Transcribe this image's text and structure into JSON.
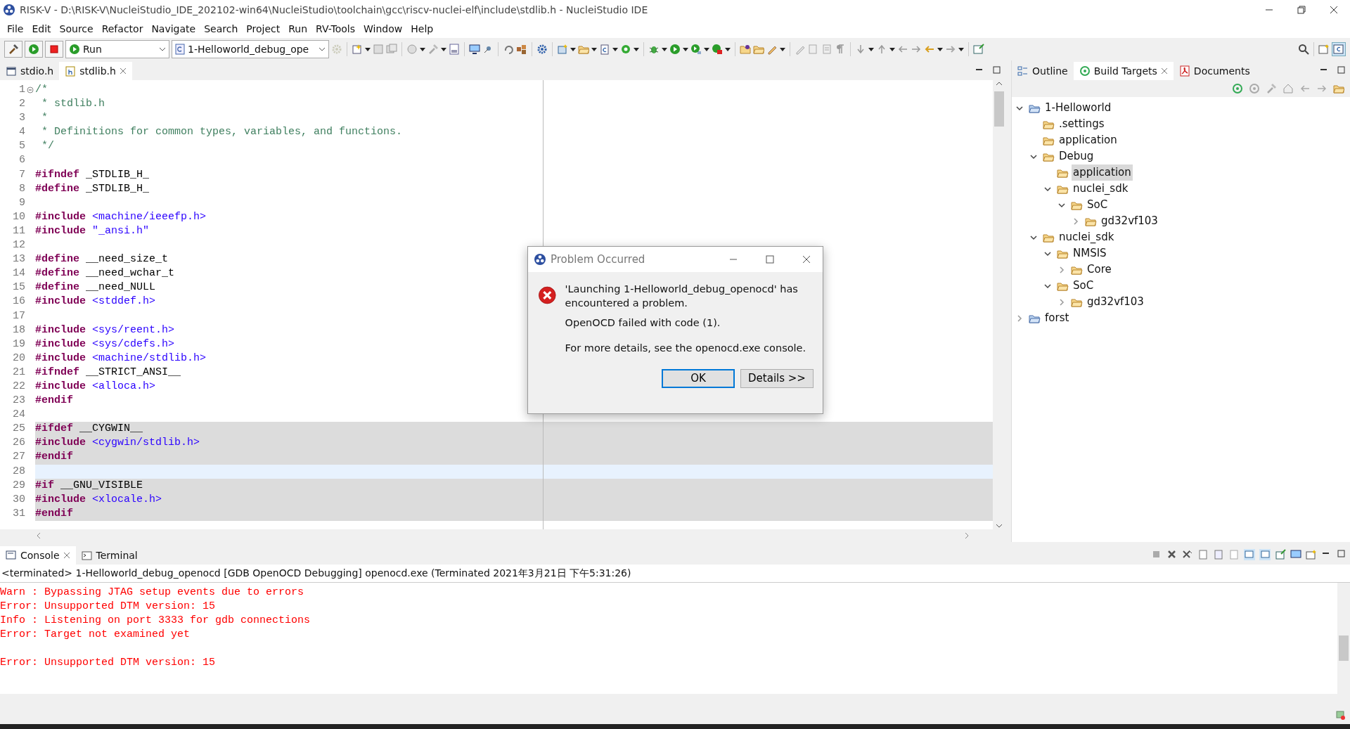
{
  "window": {
    "title": "RISK-V - D:\\RISK-V\\NucleiStudio_IDE_202102-win64\\NucleiStudio\\toolchain\\gcc\\riscv-nuclei-elf\\include\\stdlib.h - NucleiStudio IDE"
  },
  "menu": [
    "File",
    "Edit",
    "Source",
    "Refactor",
    "Navigate",
    "Search",
    "Project",
    "Run",
    "RV-Tools",
    "Window",
    "Help"
  ],
  "toolbar": {
    "launch_mode": "Run",
    "launch_config": "1-Helloworld_debug_ope"
  },
  "editor": {
    "tabs": [
      {
        "label": "stdio.h",
        "selected": false
      },
      {
        "label": "stdlib.h",
        "selected": true
      }
    ],
    "lines": [
      {
        "number": "1",
        "folded": false,
        "segments": [
          {
            "kind": "comment",
            "text": "/*"
          }
        ]
      },
      {
        "number": "2",
        "segments": [
          {
            "kind": "comment",
            "text": " * stdlib.h"
          }
        ]
      },
      {
        "number": "3",
        "segments": [
          {
            "kind": "comment",
            "text": " *"
          }
        ]
      },
      {
        "number": "4",
        "segments": [
          {
            "kind": "comment",
            "text": " * Definitions for common types, variables, and functions."
          }
        ]
      },
      {
        "number": "5",
        "segments": [
          {
            "kind": "comment",
            "text": " */"
          }
        ]
      },
      {
        "number": "6"
      },
      {
        "number": "7",
        "segments": [
          {
            "kind": "directive",
            "text": "#ifndef"
          },
          {
            "kind": "plain",
            "text": " _STDLIB_H_"
          }
        ]
      },
      {
        "number": "8",
        "segments": [
          {
            "kind": "directive",
            "text": "#define"
          },
          {
            "kind": "plain",
            "text": " _STDLIB_H_"
          }
        ]
      },
      {
        "number": "9"
      },
      {
        "number": "10",
        "segments": [
          {
            "kind": "directive",
            "text": "#include"
          },
          {
            "kind": "path",
            "text": " <machine/ieeefp.h>"
          }
        ]
      },
      {
        "number": "11",
        "segments": [
          {
            "kind": "directive",
            "text": "#include"
          },
          {
            "kind": "path",
            "text": " \"_ansi.h\""
          }
        ]
      },
      {
        "number": "12"
      },
      {
        "number": "13",
        "segments": [
          {
            "kind": "directive",
            "text": "#define"
          },
          {
            "kind": "plain",
            "text": " __need_size_t"
          }
        ]
      },
      {
        "number": "14",
        "segments": [
          {
            "kind": "directive",
            "text": "#define"
          },
          {
            "kind": "plain",
            "text": " __need_wchar_t"
          }
        ]
      },
      {
        "number": "15",
        "segments": [
          {
            "kind": "directive",
            "text": "#define"
          },
          {
            "kind": "plain",
            "text": " __need_NULL"
          }
        ]
      },
      {
        "number": "16",
        "segments": [
          {
            "kind": "directive",
            "text": "#include"
          },
          {
            "kind": "path",
            "text": " <stddef.h>"
          }
        ]
      },
      {
        "number": "17"
      },
      {
        "number": "18",
        "segments": [
          {
            "kind": "directive",
            "text": "#include"
          },
          {
            "kind": "path",
            "text": " <sys/reent.h>"
          }
        ]
      },
      {
        "number": "19",
        "segments": [
          {
            "kind": "directive",
            "text": "#include"
          },
          {
            "kind": "path",
            "text": " <sys/cdefs.h>"
          }
        ]
      },
      {
        "number": "20",
        "segments": [
          {
            "kind": "directive",
            "text": "#include"
          },
          {
            "kind": "path",
            "text": " <machine/stdlib.h>"
          }
        ]
      },
      {
        "number": "21",
        "segments": [
          {
            "kind": "directive",
            "text": "#ifndef"
          },
          {
            "kind": "plain",
            "text": " __STRICT_ANSI__"
          }
        ]
      },
      {
        "number": "22",
        "segments": [
          {
            "kind": "directive",
            "text": "#include"
          },
          {
            "kind": "path",
            "text": " <alloca.h>"
          }
        ]
      },
      {
        "number": "23",
        "segments": [
          {
            "kind": "directive",
            "text": "#endif"
          }
        ]
      },
      {
        "number": "24"
      },
      {
        "number": "25",
        "inactive": true,
        "segments": [
          {
            "kind": "directive",
            "text": "#ifdef"
          },
          {
            "kind": "plain",
            "text": " __CYGWIN__"
          }
        ]
      },
      {
        "number": "26",
        "inactive": true,
        "segments": [
          {
            "kind": "directive",
            "text": "#include"
          },
          {
            "kind": "path",
            "text": " <cygwin/stdlib.h>"
          }
        ]
      },
      {
        "number": "27",
        "inactive": true,
        "segments": [
          {
            "kind": "directive",
            "text": "#endif"
          }
        ]
      },
      {
        "number": "28",
        "current": true
      },
      {
        "number": "29",
        "inactive": true,
        "segments": [
          {
            "kind": "directive",
            "text": "#if"
          },
          {
            "kind": "plain",
            "text": " __GNU_VISIBLE"
          }
        ]
      },
      {
        "number": "30",
        "inactive": true,
        "segments": [
          {
            "kind": "directive",
            "text": "#include"
          },
          {
            "kind": "path",
            "text": " <xlocale.h>"
          }
        ]
      },
      {
        "number": "31",
        "inactive": true,
        "segments": [
          {
            "kind": "directive",
            "text": "#endif"
          }
        ]
      }
    ]
  },
  "side_panel": {
    "tabs": [
      {
        "label": "Outline",
        "selected": false
      },
      {
        "label": "Build Targets",
        "selected": true
      },
      {
        "label": "Documents",
        "selected": false
      }
    ],
    "tree": [
      {
        "kind": "project",
        "label": "1-Helloworld",
        "expanded": true,
        "selected": false,
        "children": [
          {
            "kind": "folder",
            "label": ".settings",
            "selected": false
          },
          {
            "kind": "folder",
            "label": "application",
            "selected": false
          },
          {
            "kind": "folder",
            "label": "Debug",
            "expanded": true,
            "selected": false,
            "children": [
              {
                "kind": "folder",
                "label": "application",
                "selected": true
              },
              {
                "kind": "folder",
                "label": "nuclei_sdk",
                "expanded": true,
                "selected": false,
                "children": [
                  {
                    "kind": "folder",
                    "label": "SoC",
                    "expanded": true,
                    "selected": false,
                    "children": [
                      {
                        "kind": "folder",
                        "label": "gd32vf103",
                        "expanded": false,
                        "selected": false
                      }
                    ]
                  }
                ]
              }
            ]
          },
          {
            "kind": "folder",
            "label": "nuclei_sdk",
            "expanded": true,
            "selected": false,
            "children": [
              {
                "kind": "folder",
                "label": "NMSIS",
                "expanded": true,
                "selected": false,
                "children": [
                  {
                    "kind": "folder",
                    "label": "Core",
                    "expanded": false,
                    "selected": false
                  }
                ]
              },
              {
                "kind": "folder",
                "label": "SoC",
                "expanded": true,
                "selected": false,
                "children": [
                  {
                    "kind": "folder",
                    "label": "gd32vf103",
                    "expanded": false,
                    "selected": false
                  }
                ]
              }
            ]
          }
        ]
      },
      {
        "kind": "project",
        "label": "forst",
        "expanded": false,
        "selected": false
      }
    ]
  },
  "console": {
    "tabs": [
      {
        "label": "Console",
        "selected": true
      },
      {
        "label": "Terminal",
        "selected": false
      }
    ],
    "header": "<terminated> 1-Helloworld_debug_openocd [GDB OpenOCD Debugging] openocd.exe (Terminated 2021年3月21日 下午5:31:26)",
    "blocks": [
      [
        "Warn : Bypassing JTAG setup events due to errors",
        "Error: Unsupported DTM version: 15",
        "Info : Listening on port 3333 for gdb connections",
        "Error: Target not examined yet"
      ],
      [
        "Error: Unsupported DTM version: 15"
      ]
    ]
  },
  "dialog": {
    "title": "Problem Occurred",
    "message": "'Launching 1-Helloworld_debug_openocd' has encountered a problem.",
    "reason": "OpenOCD failed with code (1).",
    "details_hint": "For more details, see the openocd.exe console.",
    "buttons": [
      {
        "label": "OK",
        "selected": true
      },
      {
        "label": "Details >>",
        "selected": false
      }
    ]
  }
}
